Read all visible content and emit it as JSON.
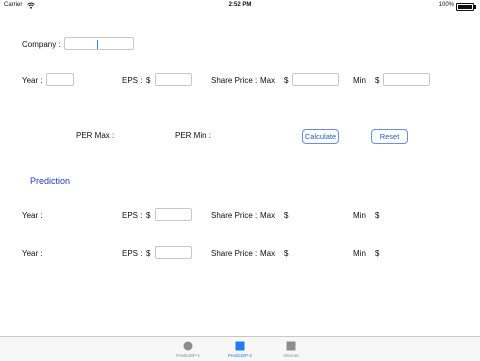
{
  "status": {
    "carrier": "Carrier",
    "time": "2:52 PM",
    "battery": "100%"
  },
  "form": {
    "company_label": "Company :",
    "company_value": "",
    "year_label": "Year :",
    "eps_label": "EPS :",
    "dollar": "$",
    "share_price_label": "Share Price :",
    "max_label": "Max",
    "min_label": "Min"
  },
  "results": {
    "per_max_label": "PER Max :",
    "per_min_label": "PER Min :"
  },
  "buttons": {
    "calculate": "Calculate",
    "reset": "Reset"
  },
  "prediction": {
    "title": "Prediction"
  },
  "tabs": [
    {
      "label": "PredictSP-1",
      "icon": "circle-icon"
    },
    {
      "label": "PredictSP-2",
      "icon": "square-icon",
      "active": true
    },
    {
      "label": "Internet",
      "icon": "square-icon"
    }
  ],
  "colors": {
    "accent": "#1f7bf0",
    "section_title": "#1f3fc4",
    "button_border": "#6a8de8"
  }
}
